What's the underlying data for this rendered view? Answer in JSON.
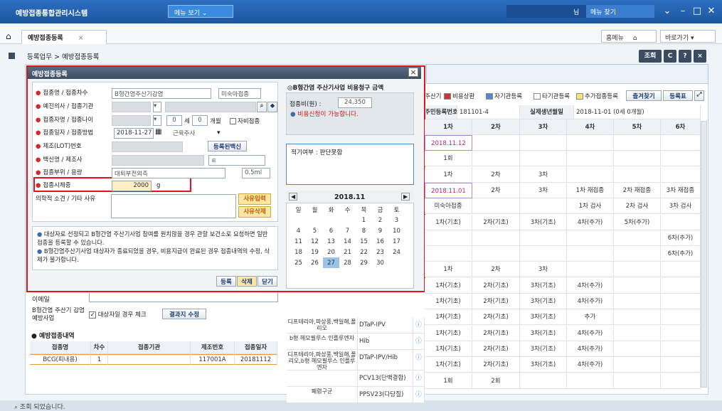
{
  "app": {
    "title": "예방접종통합관리시스템",
    "menu_view": "메뉴 보기",
    "user_suffix": "님",
    "menu_search": "메뉴 찾기"
  },
  "tabs": {
    "home_icon": "home-icon",
    "active": "예방접종등록",
    "close": "×"
  },
  "header_btns": {
    "homemenu": "홈메뉴",
    "shortcut": "바로가기"
  },
  "breadcrumb": "등록업무 > 예방접종등록",
  "toolbar": {
    "search": "조회",
    "icon1": "C",
    "help": "?",
    "close": "×"
  },
  "status": "조회 되었습니다.",
  "bg": {
    "legend": {
      "prefix": "주산기",
      "cost_pay": "비용상환",
      "self": "자기관등록",
      "other": "타기관등록",
      "add": "추가접종등록",
      "fav": "즐겨찾기",
      "reg_table": "등록표"
    },
    "info": {
      "rrn_label": "주민등록번호",
      "rrn": "181101-4",
      "birth_label": "실제생년월일",
      "birth": "2018-11-01 (0세 0개월)"
    },
    "cols": [
      "1차",
      "2차",
      "3차",
      "4차",
      "5차",
      "6차"
    ],
    "rows": [
      [
        "2018.11.12",
        "",
        "",
        "",
        "",
        ""
      ],
      [
        "1회",
        "",
        "",
        "",
        "",
        ""
      ],
      [
        "1차",
        "2차",
        "3차",
        "",
        "",
        ""
      ],
      [
        "2018.11.01",
        "2차",
        "3차",
        "1차 재접종",
        "2차 재접종",
        "3차 재접종"
      ],
      [
        "미숙아접종",
        "",
        "",
        "1차 검사",
        "2차 검사",
        "3차 검사"
      ],
      [
        "1차(기초)",
        "2차(기초)",
        "3차(기초)",
        "4차(추가)",
        "5차(추가)",
        ""
      ],
      [
        "",
        "",
        "",
        "",
        "",
        "6차(추가)"
      ],
      [
        "",
        "",
        "",
        "",
        "",
        "6차(추가)"
      ],
      [
        "1차",
        "2차",
        "3차",
        "",
        "",
        ""
      ],
      [
        "1차(기초)",
        "2차(기초)",
        "3차(기초)",
        "4차(추가)",
        "",
        ""
      ],
      [
        "1차(기초)",
        "2차(기초)",
        "3차(기초)",
        "4차(추가)",
        "",
        ""
      ],
      [
        "1차(기초)",
        "2차(기초)",
        "3차(기초)",
        "추가",
        "",
        ""
      ],
      [
        "1차(기초)",
        "2차(기초)",
        "3차(기초)",
        "4차(추가)",
        "",
        ""
      ],
      [
        "1차(기초)",
        "2차(기초)",
        "3차(기초)",
        "4차(추가)",
        "",
        ""
      ],
      [
        "1차(기초)",
        "2차(기초)",
        "3차(기초)",
        "4차(추가)",
        "",
        ""
      ],
      [
        "1회",
        "2회",
        "",
        "",
        "",
        ""
      ]
    ],
    "vaccines": [
      {
        "group": "디프테리아,파상풍,백일해,폴리오",
        "name": "DTaP-IPV"
      },
      {
        "group": "b형 헤모필루스 인플루엔자",
        "name": "Hib"
      },
      {
        "group": "디프테리아,파상풍,백일해,폴리오,b형 헤모필루스 인플루엔자",
        "name": "DTaP-IPV/Hib"
      },
      {
        "group": "",
        "name": "PCV13(단백결합)"
      },
      {
        "group": "폐렴구균",
        "name": "PPSV23(다당질)"
      }
    ],
    "email_label": "이메일",
    "hepb": {
      "label": "B형간염 주산기 감염 예방사업",
      "check": "대상자일 경우 체크",
      "btn": "결과지 수정"
    },
    "history": {
      "title": "예방접종내역",
      "cols": [
        "접종명",
        "차수",
        "접종기관",
        "제조번호",
        "접종일자"
      ],
      "row": [
        "BCG(피내용)",
        "1",
        "",
        "117001A",
        "20181112"
      ]
    }
  },
  "modal": {
    "title": "예방접종등록",
    "close": "×",
    "fields": [
      {
        "label": "접종명 / 접종차수",
        "value": "B형간염주산기감염",
        "value2": "미숙아접종"
      },
      {
        "label": "예진의사 / 접종기관",
        "value": "",
        "value2": ""
      },
      {
        "label": "접종자명 / 접종나이",
        "age_y": "0",
        "age_y_unit": "세",
        "age_m": "0",
        "age_m_unit": "개월",
        "self": "자비접종"
      },
      {
        "label": "접종일자 / 접종방법",
        "value": "2018-11-27",
        "method": "근육주사"
      },
      {
        "label": "제조(LOT)번호",
        "btn": "등록된백신"
      },
      {
        "label": "백신명 / 제조사",
        "value2": "ㅌ"
      },
      {
        "label": "접종부위 / 용량",
        "value": "대퇴부전외측",
        "dose": "0.5ml"
      },
      {
        "label": "접종시체중",
        "weight": "2000",
        "unit": "g"
      },
      {
        "label": "의학적 소견 / 기타 사유"
      }
    ],
    "reason_input": "사유입력",
    "reason_delete": "사유삭제",
    "notes": [
      "대상자로 선정되고 B형간염 주산기사업 참여를 원치않을 경우 관할 보건소로 요청하면 일반접종을 등록할 수 있습니다.",
      "B형간염주산기사업 대상자가 종료되었을 경우, 비용지급이 완료된 경우 접종내역의 수정, 삭제가 불가합니다."
    ],
    "btns": {
      "register": "등록",
      "delete": "삭제",
      "close": "닫기"
    },
    "cost": {
      "title": "B형간염 주산기사업 비용청구 금액",
      "label": "접종비(원) :",
      "amount": "24,350",
      "msg": "비용신청이 가능합니다."
    },
    "eligibility": "적기여부 : 판단못함",
    "calendar": {
      "title": "2018.11",
      "prev": "◀",
      "next": "▶",
      "days": [
        "일",
        "월",
        "화",
        "수",
        "목",
        "금",
        "토"
      ],
      "weeks": [
        [
          "",
          "",
          "",
          "",
          "1",
          "2",
          "3"
        ],
        [
          "4",
          "5",
          "6",
          "7",
          "8",
          "9",
          "10"
        ],
        [
          "11",
          "12",
          "13",
          "14",
          "15",
          "16",
          "17"
        ],
        [
          "18",
          "19",
          "20",
          "21",
          "22",
          "23",
          "24"
        ],
        [
          "25",
          "26",
          "27",
          "28",
          "29",
          "30",
          ""
        ]
      ],
      "selected": "27"
    }
  },
  "colors": {
    "accent": "#1e56a0",
    "highlight": "#e0141e",
    "modal_head": "#4a5b70"
  }
}
